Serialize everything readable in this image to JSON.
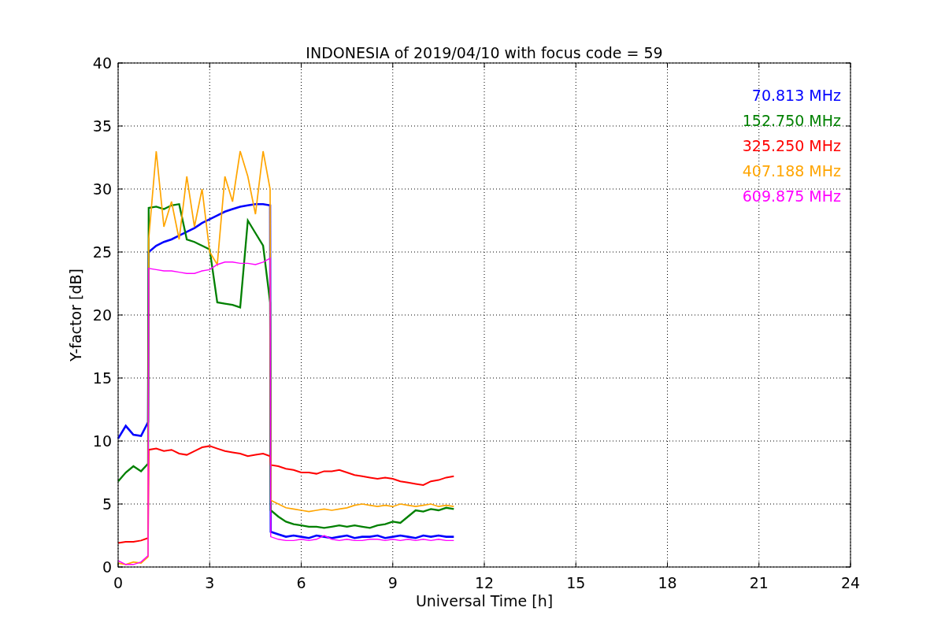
{
  "chart_data": {
    "type": "line",
    "title": "INDONESIA of 2019/04/10 with focus code = 59",
    "xlabel": "Universal Time [h]",
    "ylabel": "Y-factor [dB]",
    "x": [
      0,
      0.25,
      0.5,
      0.75,
      0.98,
      1.0,
      1.25,
      1.5,
      1.75,
      2.0,
      2.25,
      2.5,
      2.75,
      3.0,
      3.25,
      3.5,
      3.75,
      4.0,
      4.25,
      4.5,
      4.75,
      4.98,
      5.0,
      5.25,
      5.5,
      5.75,
      6.0,
      6.25,
      6.5,
      6.75,
      7.0,
      7.25,
      7.5,
      7.75,
      8.0,
      8.25,
      8.5,
      8.75,
      9.0,
      9.25,
      9.5,
      9.75,
      10.0,
      10.25,
      10.5,
      10.75,
      11.0
    ],
    "series": [
      {
        "name": "70.813 MHz",
        "color": "#0000ff",
        "values": [
          10.2,
          11.2,
          10.5,
          10.4,
          11.5,
          25.0,
          25.5,
          25.8,
          26.0,
          26.3,
          26.6,
          26.9,
          27.3,
          27.6,
          27.9,
          28.2,
          28.4,
          28.6,
          28.7,
          28.8,
          28.8,
          28.7,
          2.8,
          2.6,
          2.4,
          2.5,
          2.4,
          2.3,
          2.5,
          2.4,
          2.3,
          2.4,
          2.5,
          2.3,
          2.4,
          2.4,
          2.5,
          2.3,
          2.4,
          2.5,
          2.4,
          2.3,
          2.5,
          2.4,
          2.5,
          2.4,
          2.4
        ]
      },
      {
        "name": "152.750 MHz",
        "color": "#008000",
        "values": [
          6.8,
          7.5,
          8.0,
          7.6,
          8.2,
          28.5,
          28.6,
          28.4,
          28.7,
          28.8,
          26.0,
          25.8,
          25.5,
          25.2,
          21.0,
          20.9,
          20.8,
          20.6,
          27.5,
          26.5,
          25.5,
          21.0,
          4.5,
          4.0,
          3.6,
          3.4,
          3.3,
          3.2,
          3.2,
          3.1,
          3.2,
          3.3,
          3.2,
          3.3,
          3.2,
          3.1,
          3.3,
          3.4,
          3.6,
          3.5,
          4.0,
          4.5,
          4.4,
          4.6,
          4.5,
          4.7,
          4.6
        ]
      },
      {
        "name": "325.250 MHz",
        "color": "#ff0000",
        "values": [
          1.9,
          2.0,
          2.0,
          2.1,
          2.3,
          9.3,
          9.4,
          9.2,
          9.3,
          9.0,
          8.9,
          9.2,
          9.5,
          9.6,
          9.4,
          9.2,
          9.1,
          9.0,
          8.8,
          8.9,
          9.0,
          8.8,
          8.1,
          8.0,
          7.8,
          7.7,
          7.5,
          7.5,
          7.4,
          7.6,
          7.6,
          7.7,
          7.5,
          7.3,
          7.2,
          7.1,
          7.0,
          7.1,
          7.0,
          6.8,
          6.7,
          6.6,
          6.5,
          6.8,
          6.9,
          7.1,
          7.2
        ]
      },
      {
        "name": "407.188 MHz",
        "color": "#ffa500",
        "values": [
          0.3,
          0.2,
          0.4,
          0.3,
          0.8,
          26,
          33,
          27,
          29,
          26,
          31,
          27,
          30,
          25,
          24,
          31,
          29,
          33,
          31,
          28,
          33,
          30,
          5.3,
          5.0,
          4.7,
          4.6,
          4.5,
          4.4,
          4.5,
          4.6,
          4.5,
          4.6,
          4.7,
          4.9,
          5.0,
          4.9,
          4.8,
          4.9,
          4.8,
          5.0,
          4.9,
          4.8,
          4.9,
          5.0,
          4.8,
          4.9,
          4.8
        ]
      },
      {
        "name": "609.875 MHz",
        "color": "#ff00ff",
        "values": [
          0.5,
          0.2,
          0.2,
          0.4,
          0.9,
          23.7,
          23.6,
          23.5,
          23.5,
          23.4,
          23.3,
          23.3,
          23.5,
          23.6,
          24.0,
          24.2,
          24.2,
          24.1,
          24.1,
          24.0,
          24.2,
          24.5,
          2.4,
          2.2,
          2.1,
          2.1,
          2.2,
          2.1,
          2.2,
          2.5,
          2.2,
          2.1,
          2.2,
          2.1,
          2.1,
          2.2,
          2.2,
          2.1,
          2.2,
          2.1,
          2.2,
          2.1,
          2.2,
          2.1,
          2.2,
          2.1,
          2.1
        ]
      }
    ],
    "xlim": [
      0,
      24
    ],
    "ylim": [
      0,
      40
    ],
    "xticks": [
      0,
      3,
      6,
      9,
      12,
      15,
      18,
      21,
      24
    ],
    "yticks": [
      0,
      5,
      10,
      15,
      20,
      25,
      30,
      35,
      40
    ],
    "grid": true
  }
}
